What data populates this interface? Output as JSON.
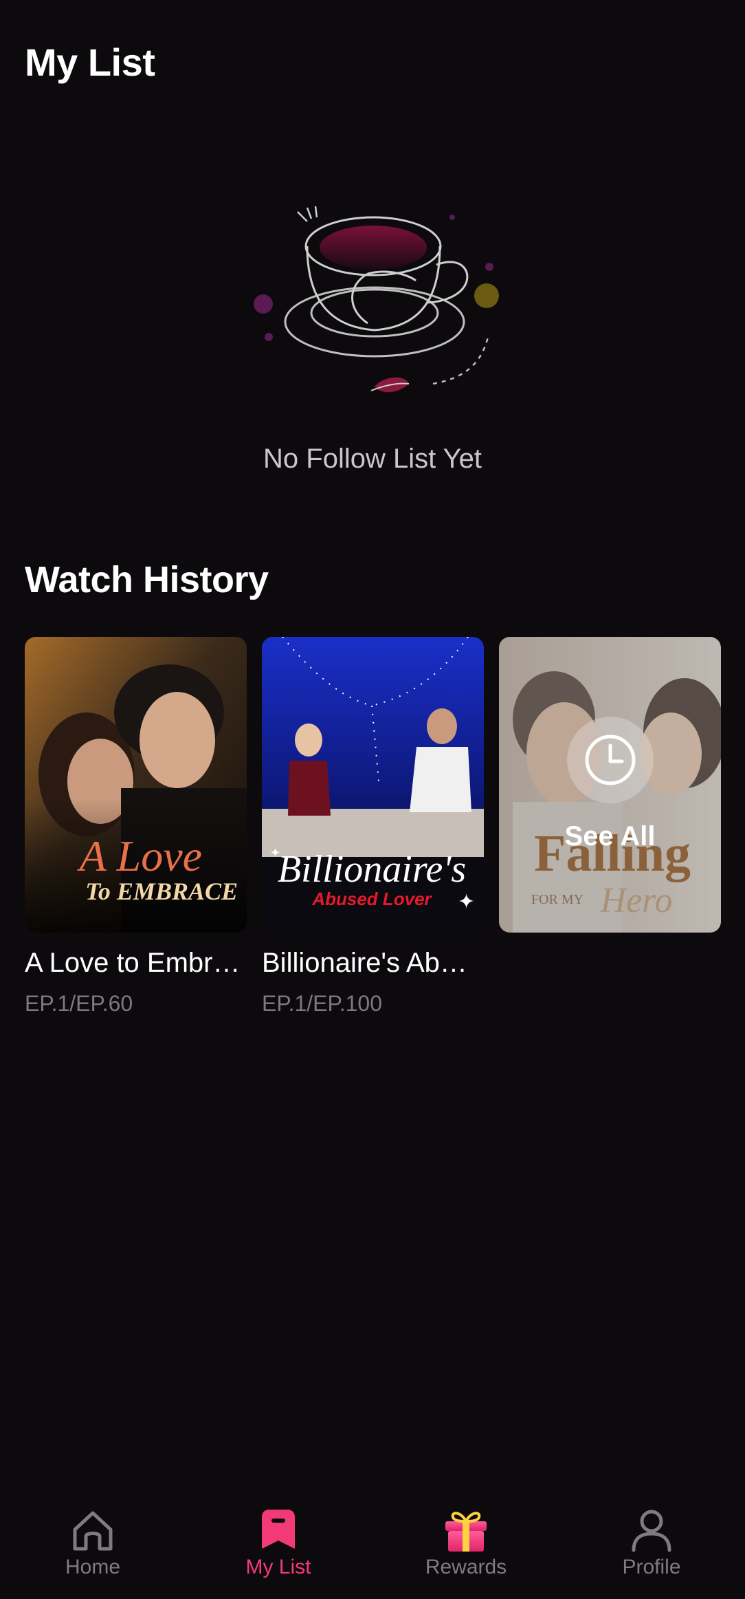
{
  "header": {
    "title": "My List"
  },
  "follow_list": {
    "empty_text": "No Follow List Yet",
    "illustration": "coffee-cup-icon"
  },
  "watch_history": {
    "title": "Watch History",
    "items": [
      {
        "title": "A Love to Embr…",
        "episode": "EP.1/EP.60",
        "poster_text_line1": "A Love",
        "poster_text_line2": "To EMBRACE"
      },
      {
        "title": "Billionaire's Ab…",
        "episode": "EP.1/EP.100",
        "poster_text_line1": "Billionaire's",
        "poster_text_line2": "Abused Lover"
      }
    ],
    "see_all": {
      "label": "See All",
      "icon": "clock-icon",
      "poster_text_line1": "Falling",
      "poster_text_line2": "FOR MY",
      "poster_text_line3": "Hero"
    }
  },
  "tabbar": {
    "tabs": [
      {
        "label": "Home",
        "icon": "home-icon",
        "active": false
      },
      {
        "label": "My List",
        "icon": "bookmark-icon",
        "active": true
      },
      {
        "label": "Rewards",
        "icon": "gift-icon",
        "active": false
      },
      {
        "label": "Profile",
        "icon": "person-icon",
        "active": false
      }
    ]
  },
  "colors": {
    "background": "#0c0a0d",
    "accent": "#f23a77",
    "inactive": "#7e7b81"
  }
}
